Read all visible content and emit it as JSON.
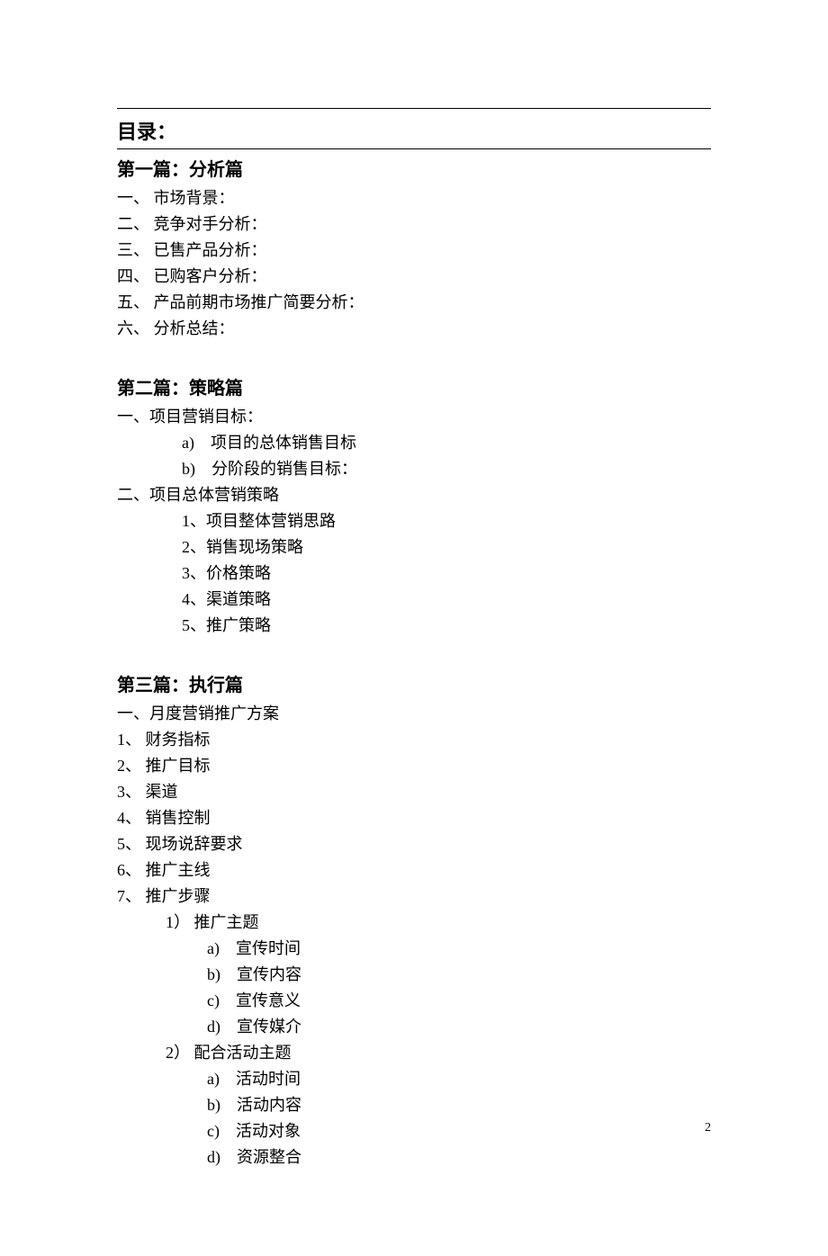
{
  "title": "目录：",
  "pageNumber": "2",
  "sections": [
    {
      "heading": "第一篇：分析篇",
      "items": [
        {
          "text": "一、 市场背景：",
          "cls": ""
        },
        {
          "text": "二、 竞争对手分析：",
          "cls": ""
        },
        {
          "text": "三、 已售产品分析：",
          "cls": ""
        },
        {
          "text": "四、 已购客户分析：",
          "cls": ""
        },
        {
          "text": "五、 产品前期市场推广简要分析：",
          "cls": ""
        },
        {
          "text": "六、 分析总结：",
          "cls": ""
        }
      ]
    },
    {
      "heading": "第二篇：策略篇",
      "items": [
        {
          "text": "一、项目营销目标：",
          "cls": ""
        },
        {
          "text": "a)　项目的总体销售目标",
          "cls": "indent-1"
        },
        {
          "text": "b)　分阶段的销售目标：",
          "cls": "indent-1"
        },
        {
          "text": "二、项目总体营销策略",
          "cls": ""
        },
        {
          "text": "1、项目整体营销思路",
          "cls": "indent-1"
        },
        {
          "text": "2、销售现场策略",
          "cls": "indent-1"
        },
        {
          "text": "3、价格策略",
          "cls": "indent-1"
        },
        {
          "text": "4、渠道策略",
          "cls": "indent-1"
        },
        {
          "text": "5、推广策略",
          "cls": "indent-1"
        }
      ]
    },
    {
      "heading": "第三篇：执行篇",
      "items": [
        {
          "text": "一、月度营销推广方案",
          "cls": ""
        },
        {
          "text": "1、 财务指标",
          "cls": ""
        },
        {
          "text": "2、 推广目标",
          "cls": ""
        },
        {
          "text": "3、 渠道",
          "cls": ""
        },
        {
          "text": "4、 销售控制",
          "cls": ""
        },
        {
          "text": "5、 现场说辞要求",
          "cls": ""
        },
        {
          "text": "6、 推广主线",
          "cls": ""
        },
        {
          "text": "7、 推广步骤",
          "cls": ""
        },
        {
          "text": "1） 推广主题",
          "cls": "indent-1b"
        },
        {
          "text": "a)　宣传时间",
          "cls": "indent-2"
        },
        {
          "text": "b)　宣传内容",
          "cls": "indent-2"
        },
        {
          "text": "c)　宣传意义",
          "cls": "indent-2"
        },
        {
          "text": "d)　宣传媒介",
          "cls": "indent-2"
        },
        {
          "text": "2） 配合活动主题",
          "cls": "indent-1b"
        },
        {
          "text": "a)　活动时间",
          "cls": "indent-2"
        },
        {
          "text": "b)　活动内容",
          "cls": "indent-2"
        },
        {
          "text": "c)　活动对象",
          "cls": "indent-2"
        },
        {
          "text": "d)　资源整合",
          "cls": "indent-2"
        }
      ]
    }
  ]
}
